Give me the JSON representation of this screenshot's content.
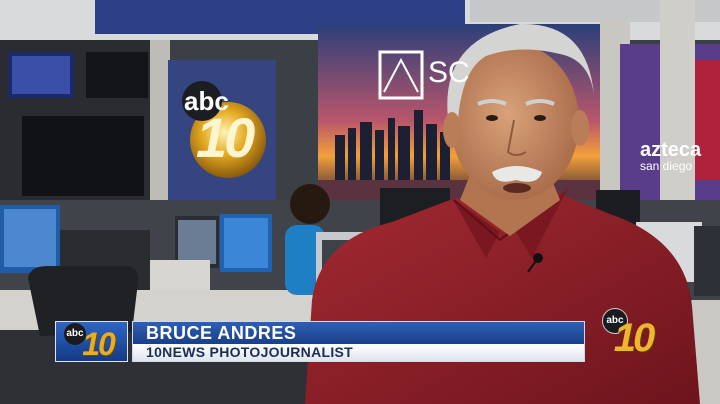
{
  "broadcast": {
    "lower_third": {
      "name": "BRUCE ANDRES",
      "title": "10NEWS PHOTOJOURNALIST"
    },
    "station_logo": {
      "network": "abc",
      "channel": "10"
    },
    "corner_bug": {
      "network": "abc",
      "channel": "10"
    },
    "background_signs": {
      "wall_logo_network": "abc",
      "wall_logo_channel": "10",
      "skyline_banner_text": "SC",
      "right_banner_line1": "azteca",
      "right_banner_line2": "san diego"
    }
  },
  "colors": {
    "lower_third_blue": "#1f4a9c",
    "lower_third_white": "#f2f4f8",
    "logo_gold": "#e0a21c",
    "shirt_red": "#8e1d26"
  }
}
